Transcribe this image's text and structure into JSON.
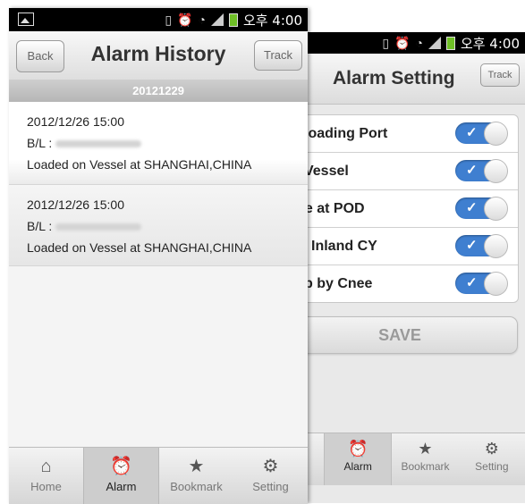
{
  "status_bar": {
    "time": "오후 4:00",
    "icons": [
      "vibrate-icon",
      "alarm-clock-icon",
      "wifi-icon",
      "signal-icon",
      "battery-icon"
    ]
  },
  "history": {
    "back_label": "Back",
    "title": "Alarm History",
    "track_label": "Track",
    "date_header": "20121229",
    "items": [
      {
        "datetime": "2012/12/26  15:00",
        "bl_label": "B/L :",
        "event": "Loaded on Vessel at SHANGHAI,CHINA"
      },
      {
        "datetime": "2012/12/26  15:00",
        "bl_label": "B/L :",
        "event": "Loaded on Vessel at SHANGHAI,CHINA"
      }
    ],
    "tabs": [
      {
        "label": "Home",
        "icon": "home-icon",
        "active": false
      },
      {
        "label": "Alarm",
        "icon": "alarm-icon",
        "active": true
      },
      {
        "label": "Bookmark",
        "icon": "star-icon",
        "active": false
      },
      {
        "label": "Setting",
        "icon": "gear-icon",
        "active": false
      }
    ]
  },
  "setting": {
    "title": "Alarm Setting",
    "track_label": "Track",
    "rows": [
      {
        "label": "in Loading Port",
        "enabled": true
      },
      {
        "label": "on Vessel",
        "enabled": true
      },
      {
        "label": "arge at POD",
        "enabled": true
      },
      {
        "label": "e at Inland CY",
        "enabled": true
      },
      {
        "label": "d up by Cnee",
        "enabled": true
      }
    ],
    "save_label": "SAVE",
    "tabs": [
      {
        "label": "Alarm",
        "icon": "alarm-icon",
        "active": true
      },
      {
        "label": "Bookmark",
        "icon": "star-icon",
        "active": false
      },
      {
        "label": "Setting",
        "icon": "gear-icon",
        "active": false
      }
    ]
  },
  "colors": {
    "toggle_on": "#3f7fd0",
    "date_bar": "#bdbdbd",
    "status_bar": "#000000"
  }
}
